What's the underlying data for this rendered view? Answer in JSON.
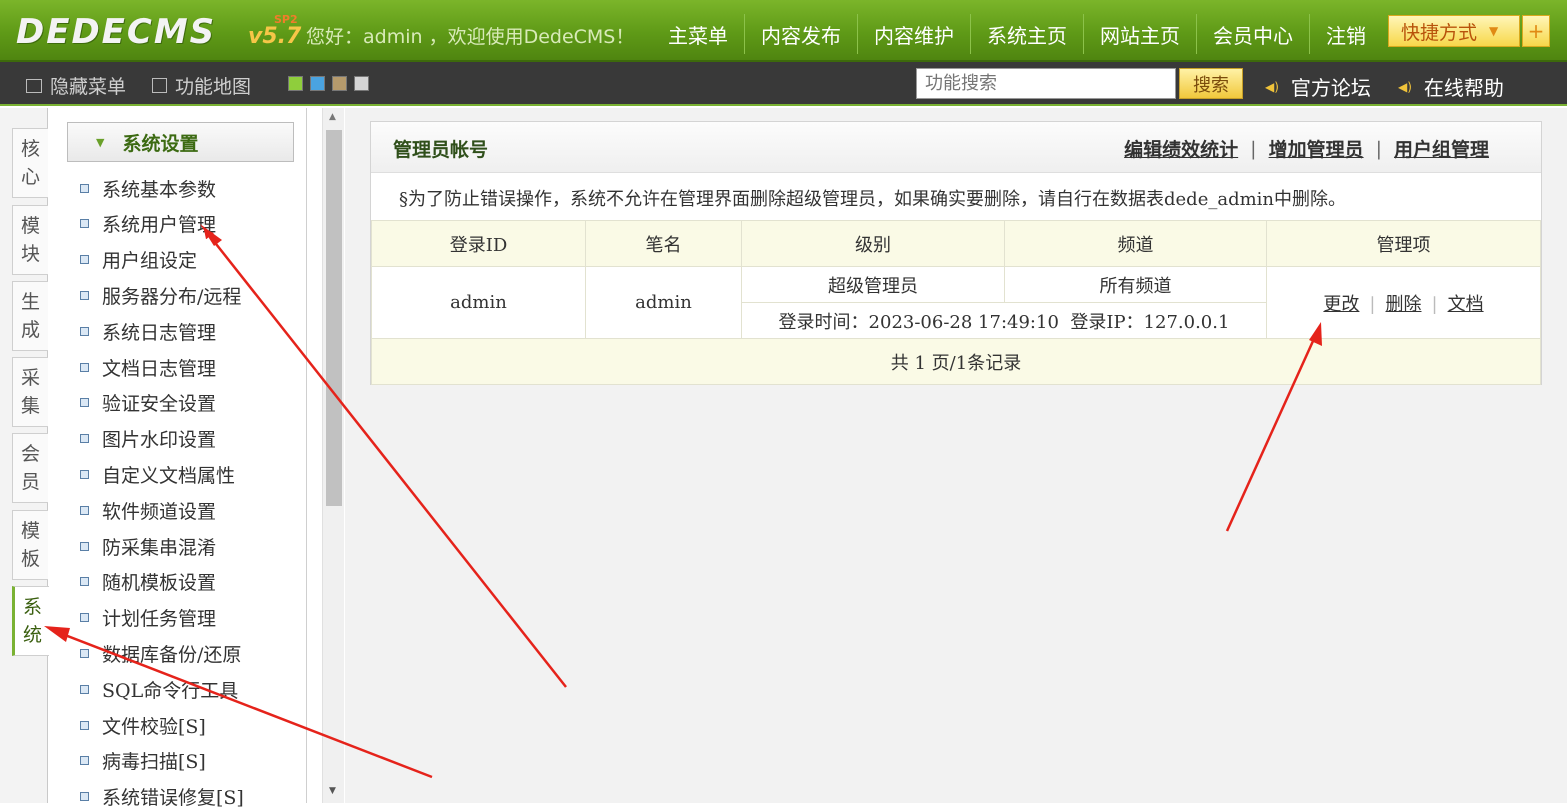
{
  "top": {
    "logo": "DEDECMS",
    "version": "v5.7",
    "sp": "SP2",
    "welcome": "您好：admin ，欢迎使用DedeCMS！",
    "nav": [
      "主菜单",
      "内容发布",
      "内容维护",
      "系统主页",
      "网站主页",
      "会员中心",
      "注销"
    ],
    "quick": "快捷方式",
    "plus": "+"
  },
  "subbar": {
    "hide_menu": "隐藏菜单",
    "func_map": "功能地图",
    "search_placeholder": "功能搜索",
    "search_button": "搜索",
    "forum": "官方论坛",
    "help": "在线帮助",
    "swatch_colors": [
      "#8fce3c",
      "#4aa3e0",
      "#b59a6c",
      "#d5d5d5"
    ]
  },
  "vtabs": [
    {
      "label": "核心"
    },
    {
      "label": "模块"
    },
    {
      "label": "生成"
    },
    {
      "label": "采集"
    },
    {
      "label": "会员"
    },
    {
      "label": "模板"
    },
    {
      "label": "系统"
    }
  ],
  "leftmenu": {
    "header": "系统设置",
    "items": [
      "系统基本参数",
      "系统用户管理",
      "用户组设定",
      "服务器分布/远程",
      "系统日志管理",
      "文档日志管理",
      "验证安全设置",
      "图片水印设置",
      "自定义文档属性",
      "软件频道设置",
      "防采集串混淆",
      "随机模板设置",
      "计划任务管理",
      "数据库备份/还原",
      "SQL命令行工具",
      "文件校验[S]",
      "病毒扫描[S]",
      "系统错误修复[S]"
    ]
  },
  "panel": {
    "title": "管理员帐号",
    "links": [
      "编辑绩效统计",
      "增加管理员",
      "用户组管理"
    ],
    "notice": "§为了防止错误操作，系统不允许在管理界面删除超级管理员，如果确实要删除，请自行在数据表dede_admin中删除。",
    "columns": [
      "登录ID",
      "笔名",
      "级别",
      "频道",
      "管理项"
    ],
    "row": {
      "login_id": "admin",
      "pen_name": "admin",
      "level": "超级管理员",
      "channel": "所有频道",
      "login_info": "登录时间：2023-06-28 17:49:10  登录IP：127.0.0.1",
      "ops": [
        "更改",
        "删除",
        "文档"
      ]
    },
    "footer": "共 1 页/1条记录"
  }
}
